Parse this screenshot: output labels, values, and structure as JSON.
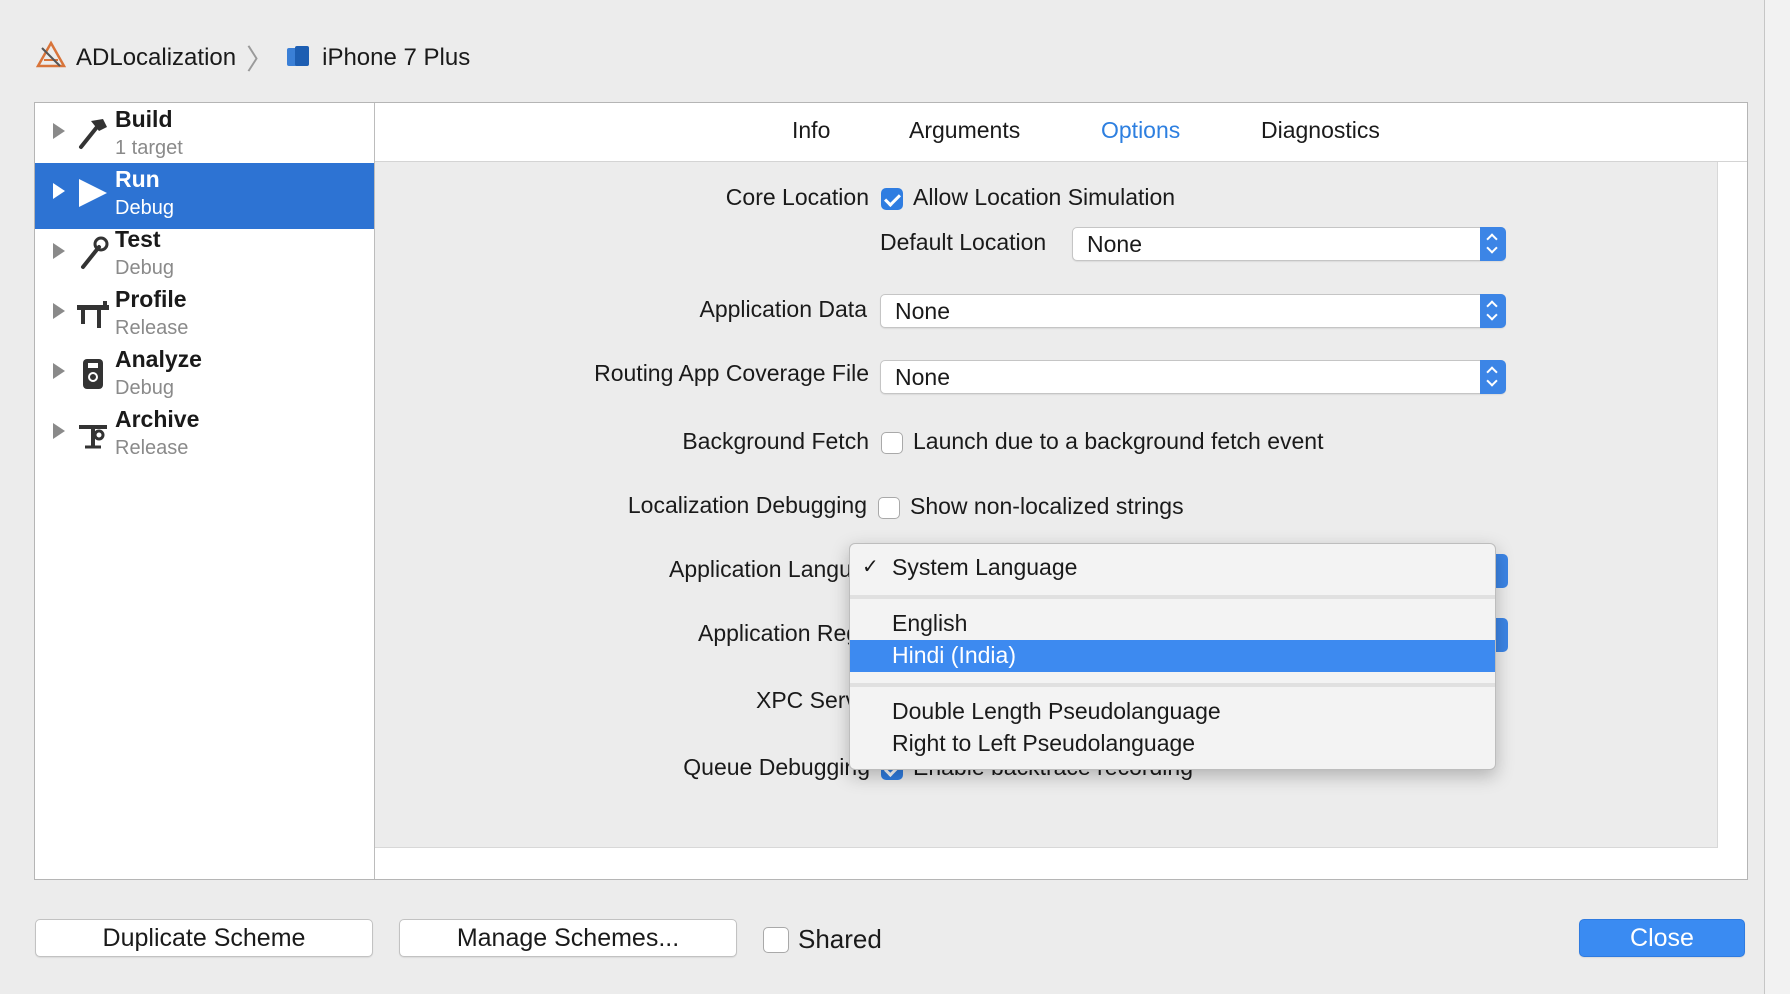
{
  "breadcrumb": {
    "project": "ADLocalization",
    "device": "iPhone 7 Plus"
  },
  "sidebar": {
    "items": [
      {
        "title": "Build",
        "subtitle": "1 target",
        "icon": "hammer-icon"
      },
      {
        "title": "Run",
        "subtitle": "Debug",
        "icon": "play-icon",
        "selected": true
      },
      {
        "title": "Test",
        "subtitle": "Debug",
        "icon": "wrench-icon"
      },
      {
        "title": "Profile",
        "subtitle": "Release",
        "icon": "caliper-icon"
      },
      {
        "title": "Analyze",
        "subtitle": "Debug",
        "icon": "analyze-icon"
      },
      {
        "title": "Archive",
        "subtitle": "Release",
        "icon": "archive-icon"
      }
    ]
  },
  "tabs": [
    "Info",
    "Arguments",
    "Options",
    "Diagnostics"
  ],
  "active_tab": "Options",
  "options": {
    "core_location": {
      "label": "Core Location",
      "checkbox_label": "Allow Location Simulation",
      "checked": true,
      "default_location_label": "Default Location",
      "default_location_value": "None"
    },
    "application_data": {
      "label": "Application Data",
      "value": "None"
    },
    "routing_coverage": {
      "label": "Routing App Coverage File",
      "value": "None"
    },
    "background_fetch": {
      "label": "Background Fetch",
      "checkbox_label": "Launch due to a background fetch event",
      "checked": false
    },
    "localization_debugging": {
      "label": "Localization Debugging",
      "checkbox_label": "Show non-localized strings",
      "checked": false
    },
    "application_language": {
      "label": "Application Language"
    },
    "application_region": {
      "label": "Application Region"
    },
    "xpc_services": {
      "label": "XPC Services"
    },
    "queue_debugging": {
      "label": "Queue Debugging",
      "checkbox_label": "Enable backtrace recording",
      "checked": true
    }
  },
  "language_menu": {
    "items": [
      {
        "label": "System Language",
        "checked": true
      },
      {
        "label": "English"
      },
      {
        "label": "Hindi (India)",
        "highlighted": true
      },
      {
        "label": "Double Length Pseudolanguage"
      },
      {
        "label": "Right to Left Pseudolanguage"
      }
    ]
  },
  "footer": {
    "duplicate_label": "Duplicate Scheme",
    "manage_label": "Manage Schemes...",
    "shared_label": "Shared",
    "close_label": "Close"
  },
  "colors": {
    "accent": "#2d73d3",
    "menu_highlight": "#3d8af0",
    "tab_active": "#2d7fe0"
  }
}
